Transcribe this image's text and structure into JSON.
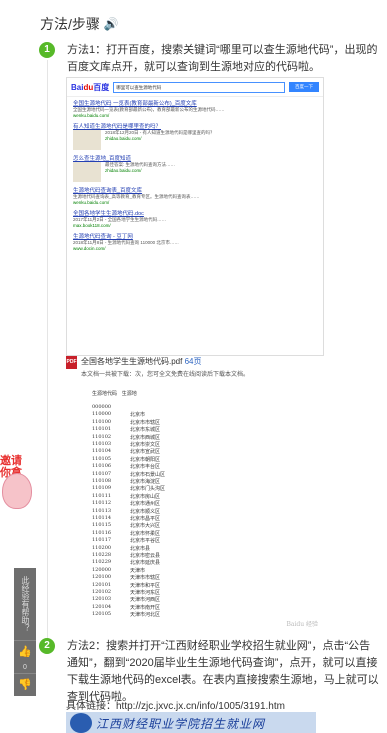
{
  "header": {
    "title": "方法/步骤",
    "speaker_icon": "speaker-icon"
  },
  "step1": {
    "num": "1",
    "text": "方法1：打开百度，搜索关键词“哪里可以查生源地代码”，出现的百度文库点开，就可以查询到生源地对应的代码啦。"
  },
  "screenshot": {
    "logo_main": "Bai",
    "logo_mark": "du",
    "logo_tail": "百度",
    "query": "哪里可以查生源地代码",
    "search_btn": "百度一下",
    "results": [
      {
        "title": "全国生源地代码 一览表(教育部最新公布)_百度文库",
        "text": "全国生源地代码一览表(教育部最新公布)，教育部最新公布的生源地代码……",
        "url": "wenku.baidu.com/"
      },
      {
        "title": "有人知道生源地代码是哪里查的吗？",
        "text": "2018年12月20日 - 有人知道生源地代码是哪里查的吗？",
        "url": "zhidao.baidu.com/"
      },
      {
        "title": "怎么查生源地_百度知道",
        "text": "最佳答案: 生源地代码查询方法……",
        "url": "zhidao.baidu.com/"
      },
      {
        "title": "生源地代码查询表_百度文库",
        "text": "生源地代码查询表_高等教育_教育专区。生源地代码查询表……",
        "url": "wenku.baidu.com/"
      },
      {
        "title": "全国各地学生生源地代码.doc",
        "text": "2017年11月2日 - 全国各地学生生源地代码……",
        "url": "max.book118.com/"
      },
      {
        "title": "生源地代码查询 - 豆丁网",
        "text": "2018年11月8日 - 生源地代码查询 110000 北京市……",
        "url": "www.docin.com/"
      }
    ]
  },
  "pdf": {
    "icon_label": "PDF",
    "title": "全国各地学生生源地代码.pdf",
    "pages": "64页",
    "subtitle": "本文档一共被下载：",
    "subtitle_tail": "次，您可全文免费在线阅读后下载本文档。"
  },
  "table": {
    "headers": [
      "生源地代码",
      "生源地"
    ],
    "rows": [
      [
        "000000",
        ""
      ],
      [
        "110000",
        "北京市"
      ],
      [
        "110100",
        "北京市市辖区"
      ],
      [
        "110101",
        "北京市东城区"
      ],
      [
        "110102",
        "北京市西城区"
      ],
      [
        "110103",
        "北京市崇文区"
      ],
      [
        "110104",
        "北京市宣武区"
      ],
      [
        "110105",
        "北京市朝阳区"
      ],
      [
        "110106",
        "北京市丰台区"
      ],
      [
        "110107",
        "北京市石景山区"
      ],
      [
        "110108",
        "北京市海淀区"
      ],
      [
        "110109",
        "北京市门头沟区"
      ],
      [
        "110111",
        "北京市房山区"
      ],
      [
        "110112",
        "北京市通州区"
      ],
      [
        "110113",
        "北京市顺义区"
      ],
      [
        "110114",
        "北京市昌平区"
      ],
      [
        "110115",
        "北京市大兴区"
      ],
      [
        "110116",
        "北京市怀柔区"
      ],
      [
        "110117",
        "北京市平谷区"
      ],
      [
        "110200",
        "北京市县"
      ],
      [
        "110228",
        "北京市密云县"
      ],
      [
        "110229",
        "北京市延庆县"
      ],
      [
        "120000",
        "天津市"
      ],
      [
        "120100",
        "天津市市辖区"
      ],
      [
        "120101",
        "天津市和平区"
      ],
      [
        "120102",
        "天津市河东区"
      ],
      [
        "120103",
        "天津市河西区"
      ],
      [
        "120104",
        "天津市南开区"
      ],
      [
        "120105",
        "天津市河北区"
      ]
    ],
    "watermark": "Baidu 经验"
  },
  "ad": {
    "text1": "邀请",
    "text2": "你拿"
  },
  "sidepanel": {
    "help_text": "此经验有帮助？",
    "like_count": "0"
  },
  "step2": {
    "num": "2",
    "text": "方法2：搜索并打开“江西财经职业学校招生就业网”，点击“公告通知”，翻到“2020届毕业生生源地代码查询”，点开，就可以直接下载生源地代码的excel表。在表内直接搜索生源地，马上就可以查到代码啦。"
  },
  "link": {
    "label": "具体链接：",
    "url": "http://zjc.jxvc.jx.cn/info/1005/3191.htm"
  },
  "banner": {
    "title": "江西财经职业学院招生就业网"
  }
}
